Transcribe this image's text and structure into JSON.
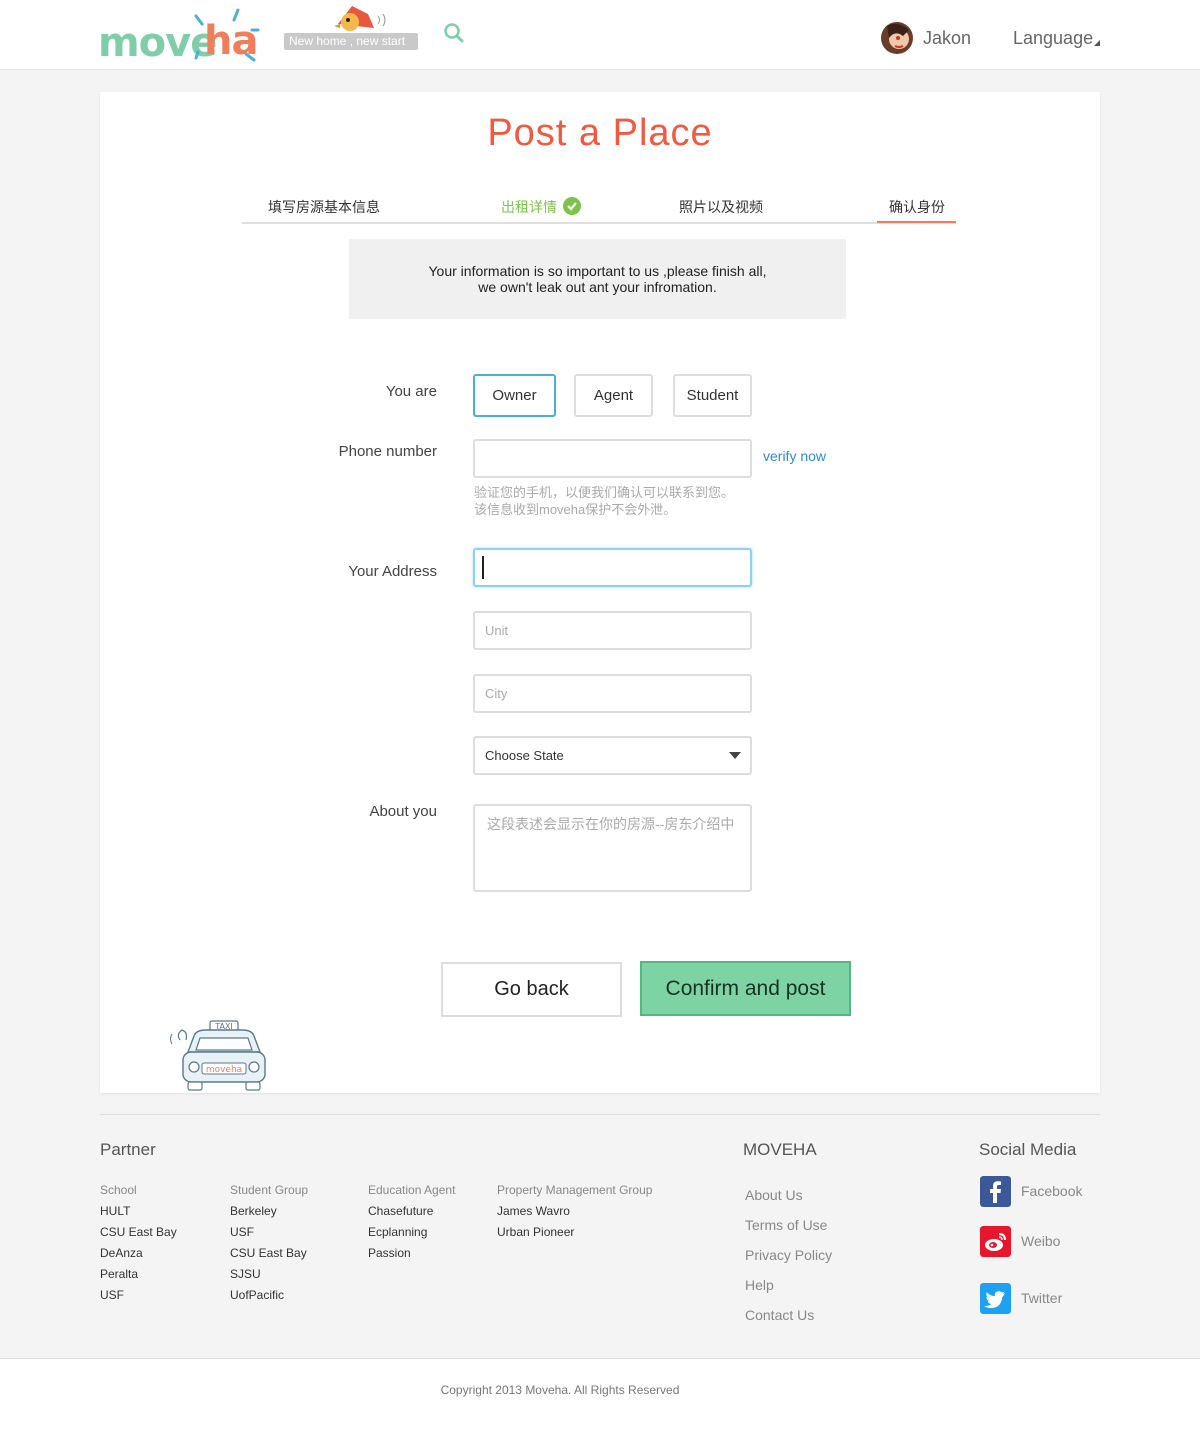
{
  "header": {
    "logo_part1": "move",
    "logo_part2": "ha",
    "tagline": "New home , new start",
    "user_name": "Jakon",
    "language_label": "Language"
  },
  "page": {
    "title": "Post  a Place",
    "steps": [
      {
        "label": "填写房源基本信息",
        "state": "default"
      },
      {
        "label": "出租详情",
        "state": "done"
      },
      {
        "label": "照片以及视频",
        "state": "default"
      },
      {
        "label": "确认身份",
        "state": "current"
      }
    ],
    "notice_line1": "Your information is so important to us ,please finish all,",
    "notice_line2": "we own't leak out ant your infromation."
  },
  "form": {
    "you_are_label": "You are",
    "roles": [
      {
        "label": "Owner",
        "selected": true
      },
      {
        "label": "Agent",
        "selected": false
      },
      {
        "label": "Student",
        "selected": false
      }
    ],
    "phone_label": "Phone number",
    "phone_value": "",
    "verify_link": "verify now",
    "phone_hint_line1": "验证您的手机，以便我们确认可以联系到您。",
    "phone_hint_line2": "该信息收到moveha保护不会外泄。",
    "address_label": "Your Address",
    "address_value": "",
    "unit_placeholder": "Unit",
    "city_placeholder": "City",
    "state_selected": "Choose State",
    "about_label": "About you",
    "about_placeholder": "这段表述会显示在你的房源--房东介绍中"
  },
  "actions": {
    "back_label": "Go back",
    "confirm_label": "Confirm and post"
  },
  "mascot": {
    "taxi_sign": "TAXI",
    "plate": "moveha"
  },
  "footer": {
    "partner_heading": "Partner",
    "partner_columns": [
      {
        "heading": "School",
        "items": [
          "HULT",
          "CSU East Bay",
          "DeAnza",
          "Peralta",
          "USF"
        ]
      },
      {
        "heading": "Student Group",
        "items": [
          "Berkeley",
          "USF",
          "CSU East Bay",
          "SJSU",
          "UofPacific"
        ]
      },
      {
        "heading": "Education Agent",
        "items": [
          "Chasefuture",
          "Ecplanning",
          "Passion"
        ]
      },
      {
        "heading": "Property Management Group",
        "items": [
          "James Wavro",
          "Urban Pioneer"
        ]
      }
    ],
    "moveha_heading": "MOVEHA",
    "moveha_links": [
      "About Us",
      "Terms of Use",
      "Privacy Policy",
      "Help",
      "Contact Us"
    ],
    "social_heading": "Social Media",
    "social_links": [
      {
        "label": "Facebook",
        "icon": "facebook-icon",
        "color": "#3b5998"
      },
      {
        "label": "Weibo",
        "icon": "weibo-icon",
        "color": "#e6162d"
      },
      {
        "label": "Twitter",
        "icon": "twitter-icon",
        "color": "#1da1f2"
      }
    ],
    "copyright": "Copyright 2013 Moveha.  All Rights Reserved"
  },
  "colors": {
    "brand_green": "#7fcea9",
    "brand_orange": "#f07e5a",
    "title_red": "#f05a40",
    "confirm_bg": "#7ed3a4",
    "link_blue": "#2d8ec9",
    "step_done": "#7dc24a"
  }
}
